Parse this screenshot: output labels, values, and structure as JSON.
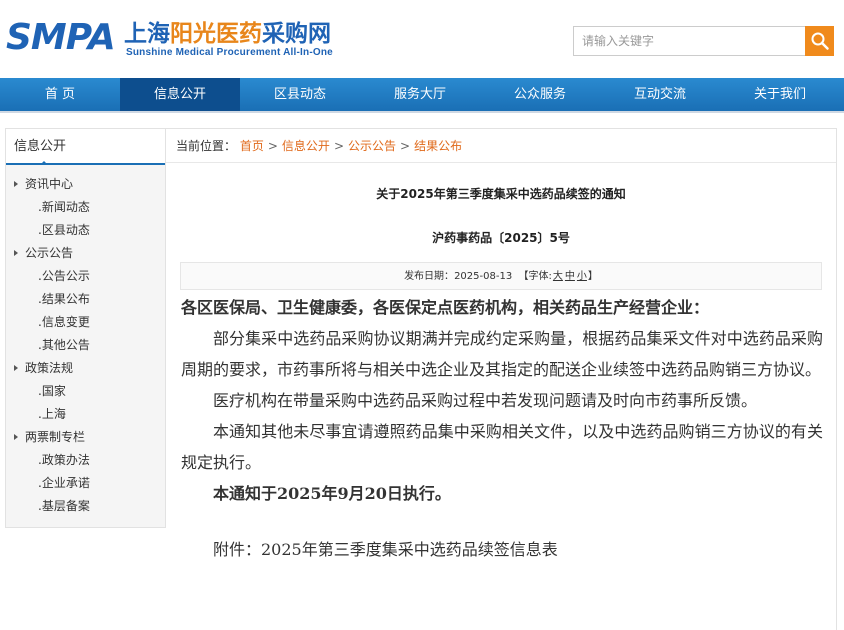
{
  "header": {
    "logo_smpa": "SMPA",
    "logo_cn_a": "上海",
    "logo_cn_b": "阳光医药",
    "logo_cn_c": "采购网",
    "logo_en": "Sunshine Medical Procurement All-In-One",
    "search_placeholder": "请输入关键字",
    "search_icon": "search-icon",
    "accent": "#f08a1c",
    "brand": "#1f63b5"
  },
  "nav": {
    "items": [
      "首 页",
      "信息公开",
      "区县动态",
      "服务大厅",
      "公众服务",
      "互动交流",
      "关于我们"
    ],
    "active_index": 1,
    "color": "#1a6fb5",
    "active_color": "#0d4e8e"
  },
  "sidebar": {
    "title": "信息公开",
    "groups": [
      {
        "label": "资讯中心",
        "items": [
          ".新闻动态",
          ".区县动态"
        ]
      },
      {
        "label": "公示公告",
        "items": [
          ".公告公示",
          ".结果公布",
          ".信息变更",
          ".其他公告"
        ]
      },
      {
        "label": "政策法规",
        "items": [
          ".国家",
          ".上海"
        ]
      },
      {
        "label": "两票制专栏",
        "items": [
          ".政策办法",
          ".企业承诺",
          ".基层备案"
        ]
      }
    ]
  },
  "breadcrumb": {
    "prefix": "当前位置：",
    "links": [
      "首页",
      "信息公开",
      "公示公告",
      "结果公布"
    ],
    "separator": ">",
    "link_color": "#e06a1b"
  },
  "article": {
    "title": "关于2025年第三季度集采中选药品续签的通知",
    "doc_number": "沪药事药品〔2025〕5号",
    "meta_date_label": "发布日期：",
    "meta_date": "2025-08-13",
    "meta_font_prefix": "【字体:",
    "meta_font_large": "大",
    "meta_font_medium": "中",
    "meta_font_small": "小",
    "meta_font_suffix": "】",
    "salutation": "各区医保局、卫生健康委，各医保定点医药机构，相关药品生产经营企业：",
    "paragraphs": [
      "部分集采中选药品采购协议期满并完成约定采购量，根据药品集采文件对中选药品采购周期的要求，市药事所将与相关中选企业及其指定的配送企业续签中选药品购销三方协议。",
      "医疗机构在带量采购中选药品采购过程中若发现问题请及时向市药事所反馈。",
      "本通知其他未尽事宜请遵照药品集中采购相关文件，以及中选药品购销三方协议的有关规定执行。"
    ],
    "effective": "本通知于2025年9月20日执行。",
    "attachment": "附件：2025年第三季度集采中选药品续签信息表"
  }
}
